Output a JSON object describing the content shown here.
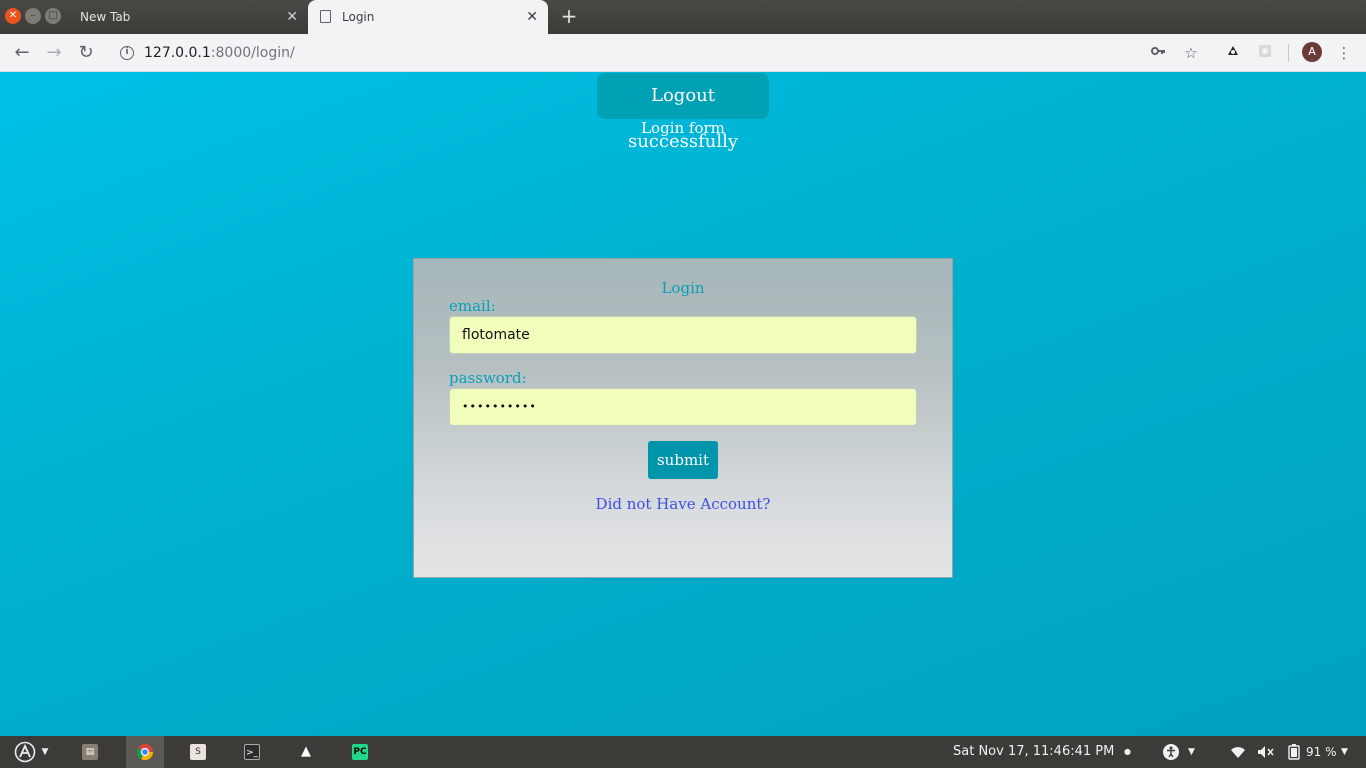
{
  "browser": {
    "tabs": [
      {
        "title": "New Tab",
        "active": false
      },
      {
        "title": "Login",
        "active": true
      }
    ],
    "new_tab_symbol": "+",
    "close_symbol": "✕",
    "url_host": "127.0.0.1",
    "url_path": ":8000/login/",
    "profile_initial": "A"
  },
  "page": {
    "flash_message": "Logout successfully",
    "heading": "Login form",
    "form": {
      "title": "Login",
      "email_label": "email:",
      "email_value": "flotomate",
      "password_label": "password:",
      "password_value": "••••••••••",
      "submit_label": "submit",
      "signup_link": "Did not Have Account?"
    }
  },
  "taskbar": {
    "apps": [
      "activities",
      "files",
      "chrome",
      "slack",
      "terminal",
      "inkscape",
      "pycharm"
    ],
    "clock": "Sat Nov 17, 11:46:41 PM",
    "battery": "91 %"
  },
  "colors": {
    "page_bg": "#00b5d6",
    "accent_text": "#0a9fb8",
    "input_bg": "#f1fdbb",
    "submit_bg": "#0095aa",
    "link": "#3d4fe6",
    "flash_bg": "#00a0b5"
  }
}
